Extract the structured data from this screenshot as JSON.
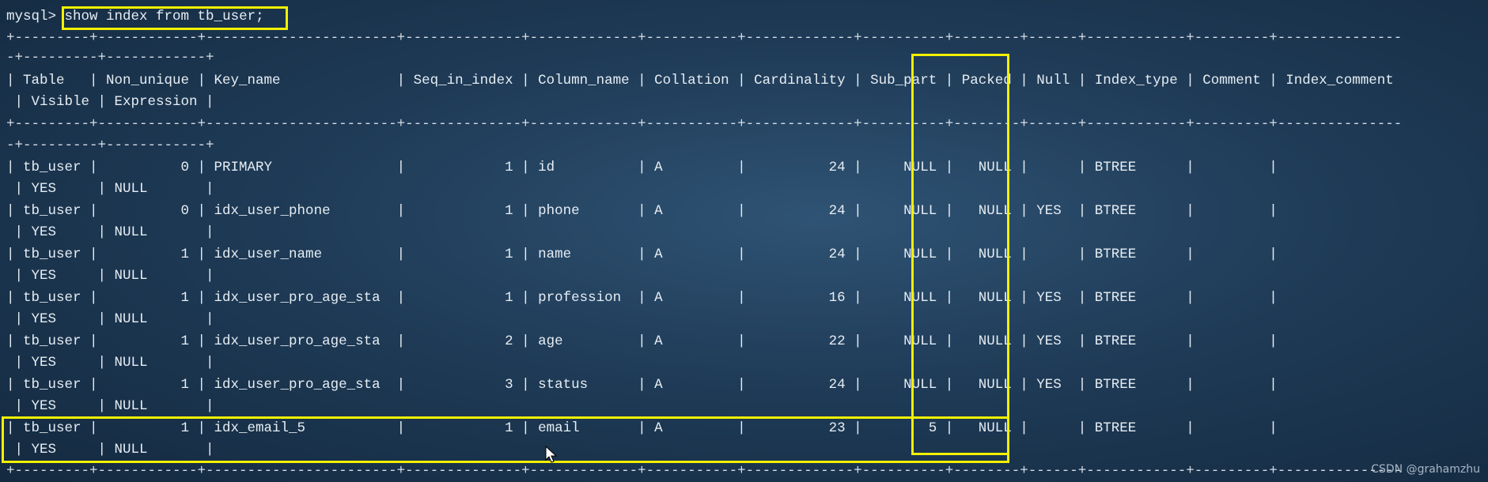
{
  "prompt": "mysql>",
  "command": "show index from tb_user;",
  "separator_top": "+---------+------------+-----------------------+--------------+-------------+-----------+-------------+----------+--------+------+------------+---------+---------------",
  "separator_wrap": "-+---------+------------+",
  "header_line1": "| Table   | Non_unique | Key_name              | Seq_in_index | Column_name | Collation | Cardinality | Sub_part | Packed | Null | Index_type | Comment | Index_comment",
  "header_line2": " | Visible | Expression |",
  "separator_mid": "+---------+------------+-----------------------+--------------+-------------+-----------+-------------+----------+--------+------+------------+---------+---------------",
  "separator_mid_wrap": "-+---------+------------+",
  "rows": [
    {
      "line1": "| tb_user |          0 | PRIMARY               |            1 | id          | A         |          24 |     NULL |   NULL |      | BTREE      |         |",
      "line2": " | YES     | NULL       |"
    },
    {
      "line1": "| tb_user |          0 | idx_user_phone        |            1 | phone       | A         |          24 |     NULL |   NULL | YES  | BTREE      |         |",
      "line2": " | YES     | NULL       |"
    },
    {
      "line1": "| tb_user |          1 | idx_user_name         |            1 | name        | A         |          24 |     NULL |   NULL |      | BTREE      |         |",
      "line2": " | YES     | NULL       |"
    },
    {
      "line1": "| tb_user |          1 | idx_user_pro_age_sta  |            1 | profession  | A         |          16 |     NULL |   NULL | YES  | BTREE      |         |",
      "line2": " | YES     | NULL       |"
    },
    {
      "line1": "| tb_user |          1 | idx_user_pro_age_sta  |            2 | age         | A         |          22 |     NULL |   NULL | YES  | BTREE      |         |",
      "line2": " | YES     | NULL       |"
    },
    {
      "line1": "| tb_user |          1 | idx_user_pro_age_sta  |            3 | status      | A         |          24 |     NULL |   NULL | YES  | BTREE      |         |",
      "line2": " | YES     | NULL       |"
    },
    {
      "line1": "| tb_user |          1 | idx_email_5           |            1 | email       | A         |          23 |        5 |   NULL |      | BTREE      |         |",
      "line2": " | YES     | NULL       |"
    }
  ],
  "separator_bottom": "+---------+------------+-----------------------+--------------+-------------+-----------+-------------+----------+--------+------+------------+---------+---------------",
  "watermark": "CSDN @grahamzhu",
  "colors": {
    "highlight": "#f3f000",
    "text": "#e6edf3"
  }
}
